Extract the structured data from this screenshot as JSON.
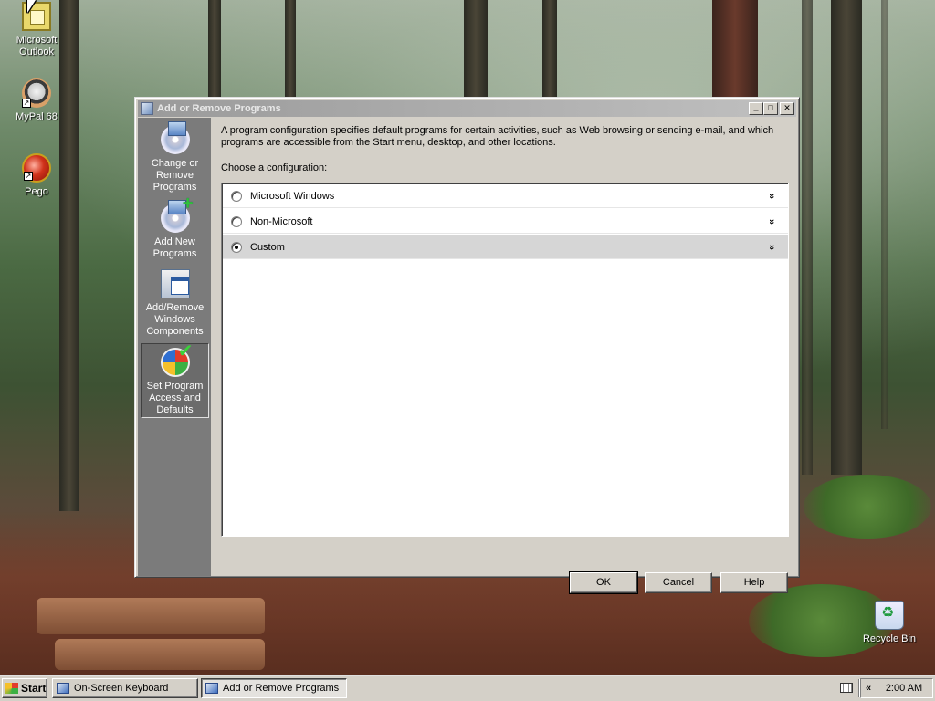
{
  "desktop": {
    "icons": [
      {
        "label": "Microsoft Outlook",
        "icon": "outlook-icon"
      },
      {
        "label": "MyPal 68",
        "icon": "mypal-icon"
      },
      {
        "label": "Pego",
        "icon": "pego-icon"
      },
      {
        "label": "Recycle Bin",
        "icon": "recycle-bin-icon"
      }
    ],
    "shortcut_arrow": "↗"
  },
  "window": {
    "title": "Add or Remove Programs",
    "buttons": {
      "minimize": "_",
      "maximize": "□",
      "close": "✕"
    },
    "sidebar": {
      "items": [
        {
          "label": "Change or Remove Programs",
          "icon": "change-remove-programs-icon"
        },
        {
          "label": "Add New Programs",
          "icon": "add-new-programs-icon"
        },
        {
          "label": "Add/Remove Windows Components",
          "icon": "windows-components-icon"
        },
        {
          "label": "Set Program Access and Defaults",
          "icon": "program-access-defaults-icon"
        }
      ],
      "active_index": 3
    },
    "description": "A program configuration specifies default programs for certain activities, such as Web browsing or sending e-mail, and which programs are accessible from the Start menu, desktop, and other locations.",
    "choose_label": "Choose a configuration:",
    "options": [
      {
        "label": "Microsoft Windows",
        "selected": false
      },
      {
        "label": "Non-Microsoft",
        "selected": false
      },
      {
        "label": "Custom",
        "selected": true
      }
    ],
    "expand_glyph": "»",
    "buttons_bottom": {
      "ok": "OK",
      "cancel": "Cancel",
      "help": "Help"
    }
  },
  "taskbar": {
    "start_label": "Start",
    "tasks": [
      {
        "label": "On-Screen Keyboard",
        "active": false
      },
      {
        "label": "Add or Remove Programs",
        "active": true
      }
    ],
    "tray_chevron": "«",
    "clock": "2:00 AM"
  }
}
